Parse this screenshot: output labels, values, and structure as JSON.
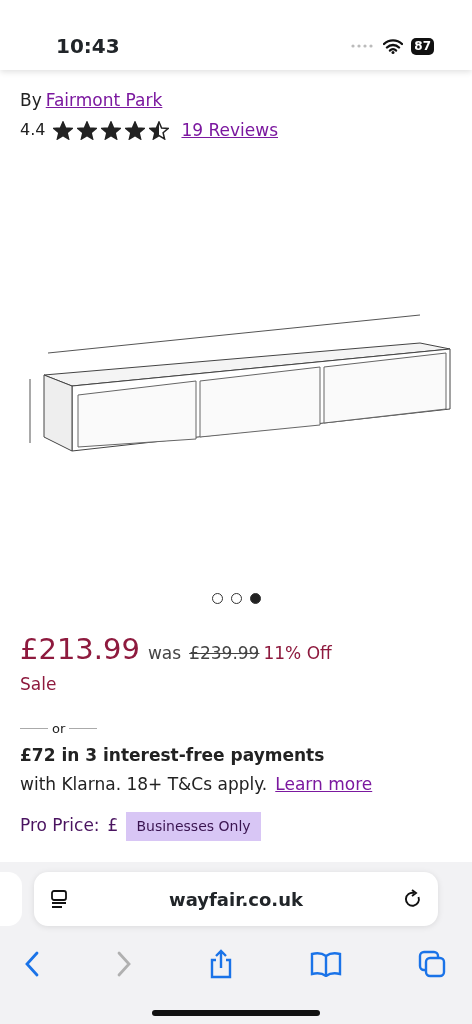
{
  "status_bar": {
    "time": "10:43",
    "battery": "87"
  },
  "product": {
    "brand_prefix": "By",
    "brand": "Fairmont Park",
    "rating": "4.4",
    "stars": 4.5,
    "reviews": "19 Reviews"
  },
  "gallery": {
    "dots": [
      {
        "selected": false
      },
      {
        "selected": false
      },
      {
        "selected": true
      }
    ]
  },
  "pricing": {
    "price": "£213.99",
    "was_label": "was",
    "was_price": "£239.99",
    "discount": "11% Off",
    "sale": "Sale",
    "or": "or",
    "klarna_title": "£72 in 3 interest-free payments",
    "klarna_text": "with Klarna. 18+ T&Cs apply.",
    "klarna_link": "Learn more",
    "pro_label": "Pro Price:",
    "pro_currency": "£",
    "pro_badge": "Businesses Only"
  },
  "browser": {
    "url": "wayfair.co.uk",
    "toolbar": [
      {
        "kind": "back",
        "disabled": false
      },
      {
        "kind": "forward",
        "disabled": true
      },
      {
        "kind": "share",
        "disabled": false
      },
      {
        "kind": "bookmarks",
        "disabled": false
      },
      {
        "kind": "tabs",
        "disabled": false
      }
    ]
  }
}
